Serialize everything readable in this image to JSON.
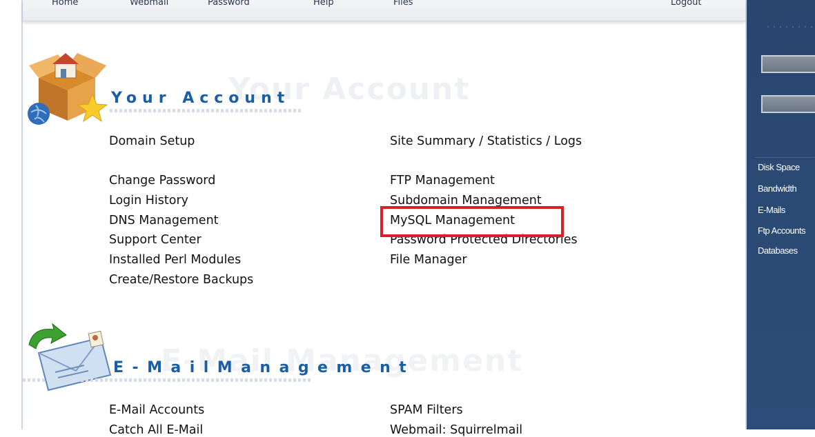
{
  "top_nav": {
    "items": [
      "Home",
      "Webmail",
      "Password",
      "Help",
      "Files"
    ],
    "logout": "Logout"
  },
  "your_account": {
    "title": "Your Account",
    "col1": [
      "Domain Setup",
      "Change Password",
      "Login History",
      "DNS Management",
      "Support Center",
      "Installed Perl Modules",
      "Create/Restore Backups"
    ],
    "col2": [
      "Site Summary / Statistics / Logs",
      "FTP Management",
      "Subdomain Management",
      "MySQL Management",
      "Password Protected Directories",
      "File Manager"
    ]
  },
  "email_management": {
    "title": "E-Mail Management",
    "display_title": "E - M a i l   M a n a g e m e n t",
    "col1": [
      "E-Mail Accounts",
      "Catch All E-Mail"
    ],
    "col2": [
      "SPAM Filters",
      "Webmail: Squirrelmail"
    ]
  },
  "sidebar_stats": {
    "items": [
      "Disk Space",
      "Bandwidth",
      "E-Mails",
      "Ftp Accounts",
      "Databases"
    ]
  },
  "colors": {
    "title_blue": "#1a5fa5",
    "highlight_red": "#d8202a",
    "sidebar_blue": "#2c4d79"
  }
}
